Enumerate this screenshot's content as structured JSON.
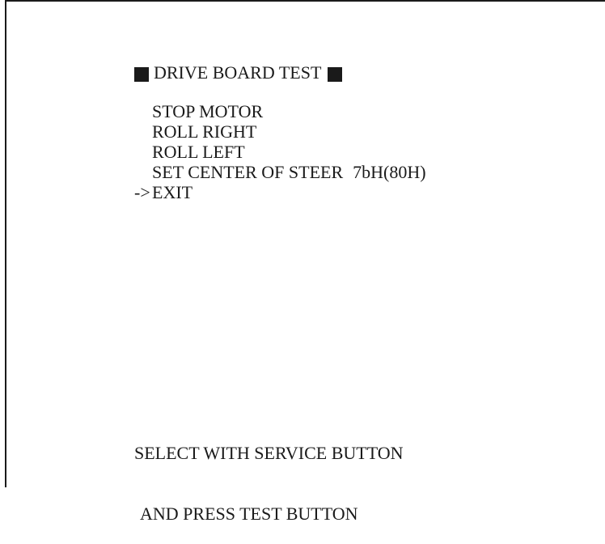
{
  "screen": {
    "title": "DRIVE BOARD TEST",
    "title_marker_icon": "filled-square-icon"
  },
  "menu": {
    "cursor_symbol": "->",
    "selected_index": 4,
    "items": [
      {
        "label": "STOP MOTOR",
        "value": ""
      },
      {
        "label": "ROLL RIGHT",
        "value": ""
      },
      {
        "label": "ROLL LEFT",
        "value": ""
      },
      {
        "label": "SET CENTER OF STEER",
        "value": "7bH(80H)"
      },
      {
        "label": "EXIT",
        "value": ""
      }
    ]
  },
  "footer": {
    "line1": "SELECT WITH SERVICE BUTTON",
    "line2": "AND PRESS TEST BUTTON"
  },
  "colors": {
    "background": "#ffffff",
    "text": "#1a1a1a"
  }
}
